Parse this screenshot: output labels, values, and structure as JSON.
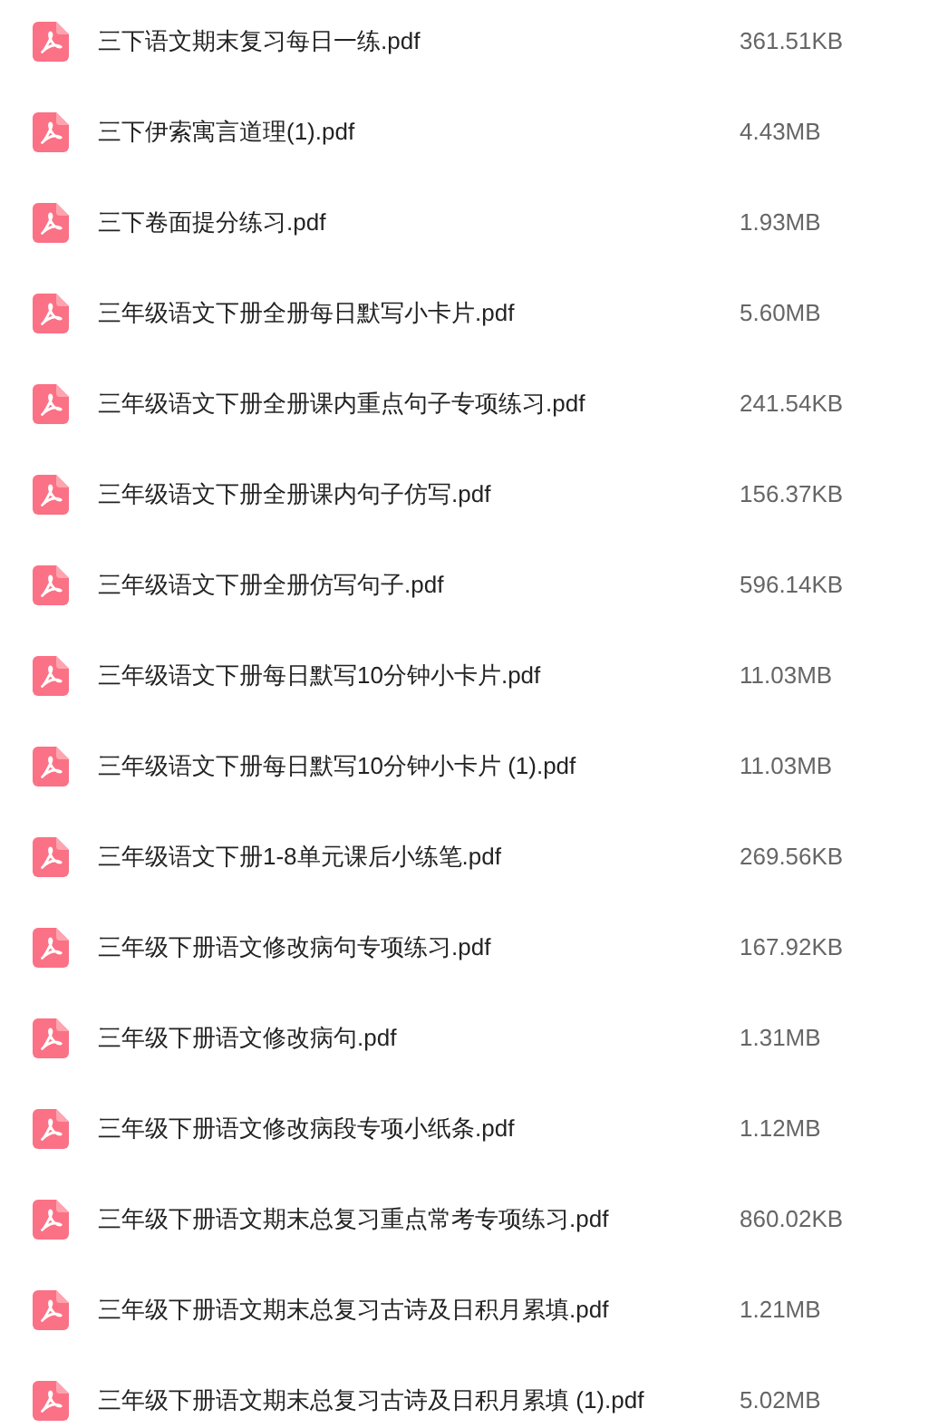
{
  "files": [
    {
      "name": "三下语文期末复习每日一练.pdf",
      "size": "361.51KB"
    },
    {
      "name": "三下伊索寓言道理(1).pdf",
      "size": "4.43MB"
    },
    {
      "name": "三下卷面提分练习.pdf",
      "size": "1.93MB"
    },
    {
      "name": "三年级语文下册全册每日默写小卡片.pdf",
      "size": "5.60MB"
    },
    {
      "name": "三年级语文下册全册课内重点句子专项练习.pdf",
      "size": "241.54KB"
    },
    {
      "name": "三年级语文下册全册课内句子仿写.pdf",
      "size": "156.37KB"
    },
    {
      "name": "三年级语文下册全册仿写句子.pdf",
      "size": "596.14KB"
    },
    {
      "name": "三年级语文下册每日默写10分钟小卡片.pdf",
      "size": "11.03MB"
    },
    {
      "name": "三年级语文下册每日默写10分钟小卡片 (1).pdf",
      "size": "11.03MB"
    },
    {
      "name": "三年级语文下册1-8单元课后小练笔.pdf",
      "size": "269.56KB"
    },
    {
      "name": "三年级下册语文修改病句专项练习.pdf",
      "size": "167.92KB"
    },
    {
      "name": "三年级下册语文修改病句.pdf",
      "size": "1.31MB"
    },
    {
      "name": "三年级下册语文修改病段专项小纸条.pdf",
      "size": "1.12MB"
    },
    {
      "name": "三年级下册语文期末总复习重点常考专项练习.pdf",
      "size": "860.02KB"
    },
    {
      "name": "三年级下册语文期末总复习古诗及日积月累填.pdf",
      "size": "1.21MB"
    },
    {
      "name": "三年级下册语文期末总复习古诗及日积月累填 (1).pdf",
      "size": "5.02MB"
    }
  ]
}
